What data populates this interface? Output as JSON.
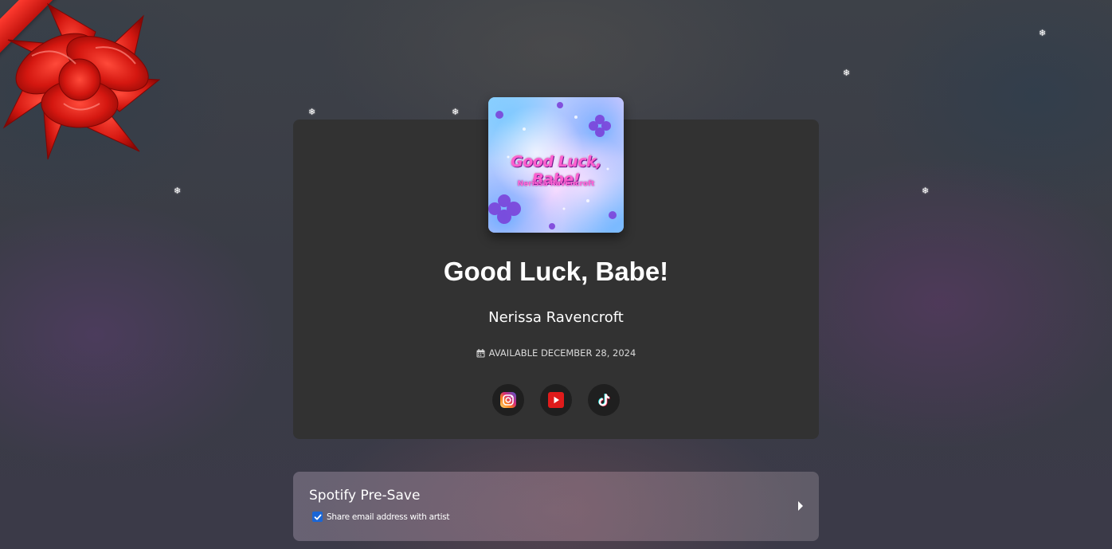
{
  "release": {
    "title": "Good Luck, Babe!",
    "artist": "Nerissa Ravencroft",
    "availability": "AVAILABLE DECEMBER 28, 2024",
    "cover": {
      "title_text": "Good Luck, Babe!",
      "artist_text": "Nerissa Ravencroft"
    }
  },
  "socials": [
    {
      "name": "instagram",
      "icon": "instagram-icon"
    },
    {
      "name": "youtube",
      "icon": "youtube-icon"
    },
    {
      "name": "tiktok",
      "icon": "tiktok-icon"
    }
  ],
  "presave": {
    "label": "Spotify Pre-Save",
    "share_email": {
      "label": "Share email address with artist",
      "checked": true
    }
  },
  "decorations": {
    "snowflake_glyph": "❄",
    "ribbon_color": "#e0201a",
    "accent_checkbox": "#1a66d6"
  }
}
